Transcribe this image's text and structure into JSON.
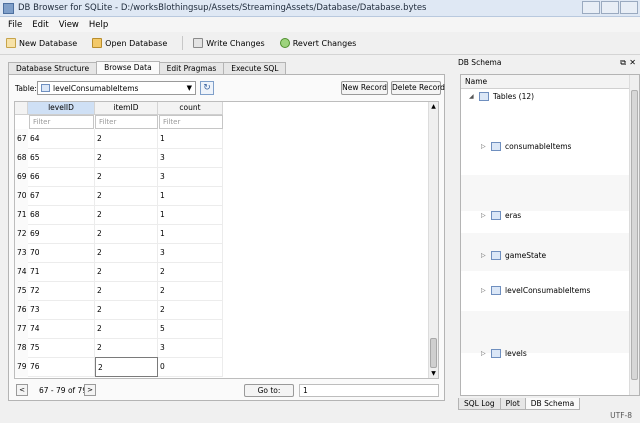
{
  "window": {
    "title": "DB Browser for SQLite - D:/worksBlothingsup/Assets/StreamingAssets/Database/Database.bytes"
  },
  "menu": [
    "File",
    "Edit",
    "View",
    "Help"
  ],
  "toolbar": {
    "new_database": "New Database",
    "open_database": "Open Database",
    "write_changes": "Write Changes",
    "revert_changes": "Revert Changes"
  },
  "tabs": [
    "Database Structure",
    "Browse Data",
    "Edit Pragmas",
    "Execute SQL"
  ],
  "active_tab": "Browse Data",
  "browse": {
    "table_label": "Table:",
    "table_value": "levelConsumableItems",
    "new_record": "New Record",
    "delete_record": "Delete Record",
    "columns": [
      "levelID",
      "itemID",
      "count"
    ],
    "filter_placeholder": "Filter",
    "rows": [
      {
        "num": "67",
        "levelID": "64",
        "itemID": "2",
        "count": "1"
      },
      {
        "num": "68",
        "levelID": "65",
        "itemID": "2",
        "count": "3"
      },
      {
        "num": "69",
        "levelID": "66",
        "itemID": "2",
        "count": "3"
      },
      {
        "num": "70",
        "levelID": "67",
        "itemID": "2",
        "count": "1"
      },
      {
        "num": "71",
        "levelID": "68",
        "itemID": "2",
        "count": "1"
      },
      {
        "num": "72",
        "levelID": "69",
        "itemID": "2",
        "count": "1"
      },
      {
        "num": "73",
        "levelID": "70",
        "itemID": "2",
        "count": "3"
      },
      {
        "num": "74",
        "levelID": "71",
        "itemID": "2",
        "count": "2"
      },
      {
        "num": "75",
        "levelID": "72",
        "itemID": "2",
        "count": "2"
      },
      {
        "num": "76",
        "levelID": "73",
        "itemID": "2",
        "count": "2"
      },
      {
        "num": "77",
        "levelID": "74",
        "itemID": "2",
        "count": "5"
      },
      {
        "num": "78",
        "levelID": "75",
        "itemID": "2",
        "count": "3"
      },
      {
        "num": "79",
        "levelID": "76",
        "itemID": "2",
        "count": "0"
      }
    ],
    "nav": {
      "prev": "<",
      "range": "67 - 79 of 79",
      "next": ">",
      "goto_label": "Go to:",
      "goto_value": "1"
    }
  },
  "schema": {
    "title": "DB Schema",
    "header": "Name",
    "tables_label": "Tables (12)",
    "items": [
      "consumableItems",
      "eras",
      "gameState",
      "levelConsumableItems",
      "levels"
    ]
  },
  "bottom_tabs": [
    "SQL Log",
    "Plot",
    "DB Schema"
  ],
  "status": {
    "encoding": "UTF-8"
  }
}
